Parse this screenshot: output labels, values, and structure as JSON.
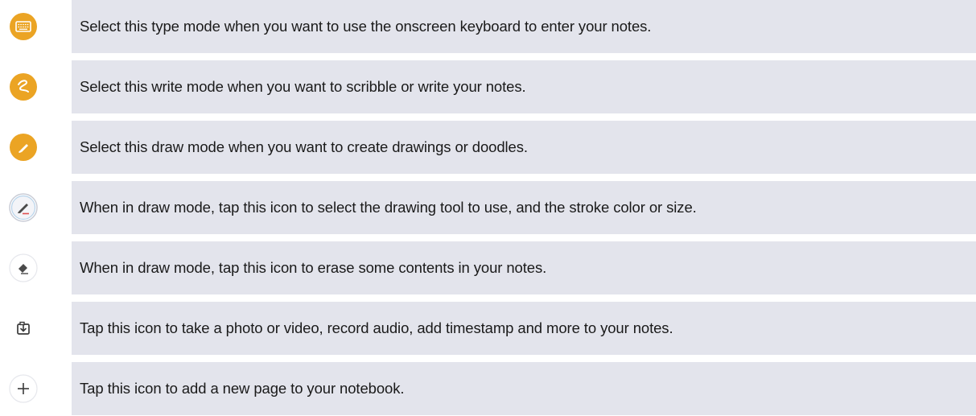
{
  "accent_color": "#eba424",
  "rows": [
    {
      "icon": "keyboard-icon",
      "text": "Select this type mode when you want to use the onscreen keyboard to enter your notes."
    },
    {
      "icon": "scribble-icon",
      "text": "Select this write mode when you want to scribble or write your notes."
    },
    {
      "icon": "brush-icon",
      "text": "Select this draw mode when you want to create drawings or doodles."
    },
    {
      "icon": "pen-icon",
      "text": "When in draw mode, tap this icon to select the drawing tool to use, and the stroke color or size."
    },
    {
      "icon": "eraser-icon",
      "text": "When in draw mode, tap this icon to erase some contents in your notes."
    },
    {
      "icon": "insert-icon",
      "text": "Tap this icon to take a photo or video, record audio, add timestamp and more to your notes."
    },
    {
      "icon": "plus-icon",
      "text": "Tap this icon to add a new page to your notebook."
    }
  ]
}
